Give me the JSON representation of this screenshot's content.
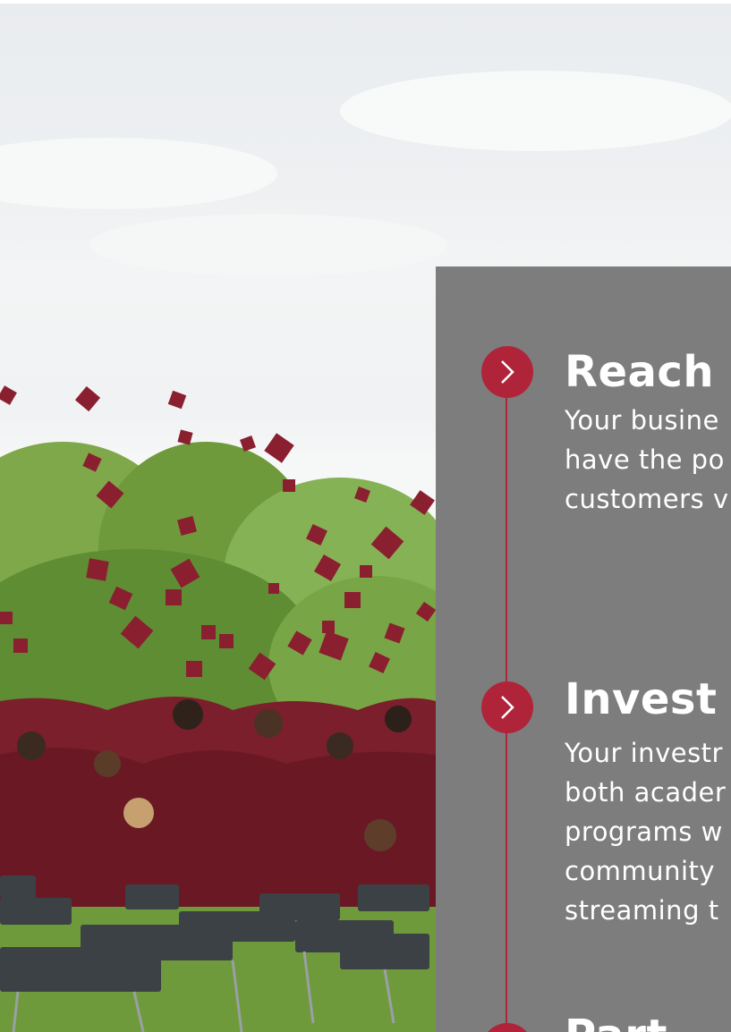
{
  "hero": {
    "image_alt": "Graduates in maroon gowns tossing caps into the air",
    "colors": {
      "gown": "#7a1f2b",
      "foliage": "#6f9a3c",
      "sky": "#eef0f2"
    }
  },
  "panel": {
    "background": "#7d7d7d",
    "accent": "#b0243a",
    "items": [
      {
        "title": "Reach",
        "body_lines": [
          "Your busine",
          "have the po",
          "customers v"
        ]
      },
      {
        "title": "Invest",
        "body_lines": [
          "Your investr",
          "both acader",
          "programs w",
          "community",
          "streaming t"
        ]
      },
      {
        "title": "Part",
        "body_lines": []
      }
    ]
  }
}
